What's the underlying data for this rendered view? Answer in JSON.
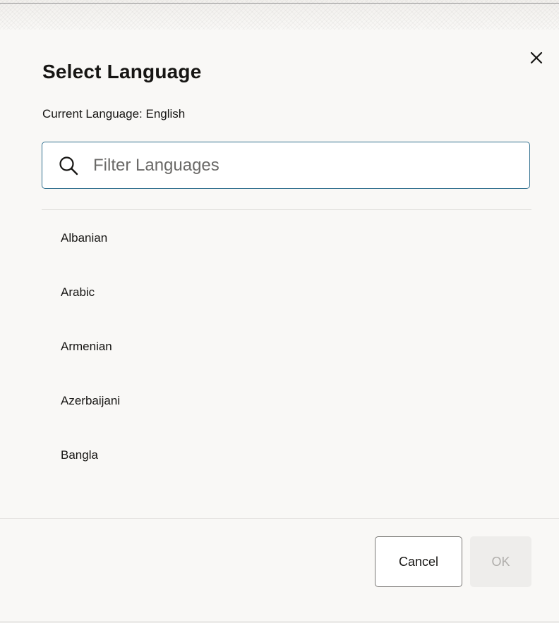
{
  "dialog": {
    "title": "Select Language",
    "current_language_text": "Current Language: English",
    "close_icon": "close-icon",
    "search": {
      "icon": "search-icon",
      "placeholder": "Filter Languages",
      "value": ""
    },
    "languages": [
      "Albanian",
      "Arabic",
      "Armenian",
      "Azerbaijani",
      "Bangla"
    ],
    "buttons": {
      "cancel_label": "Cancel",
      "ok_label": "OK",
      "ok_enabled": false
    }
  },
  "colors": {
    "background": "#f9f8f6",
    "text": "#161513",
    "input_focus_border": "#31708f",
    "disabled_button_bg": "#eeedeb",
    "disabled_button_text": "#b0aeab"
  }
}
